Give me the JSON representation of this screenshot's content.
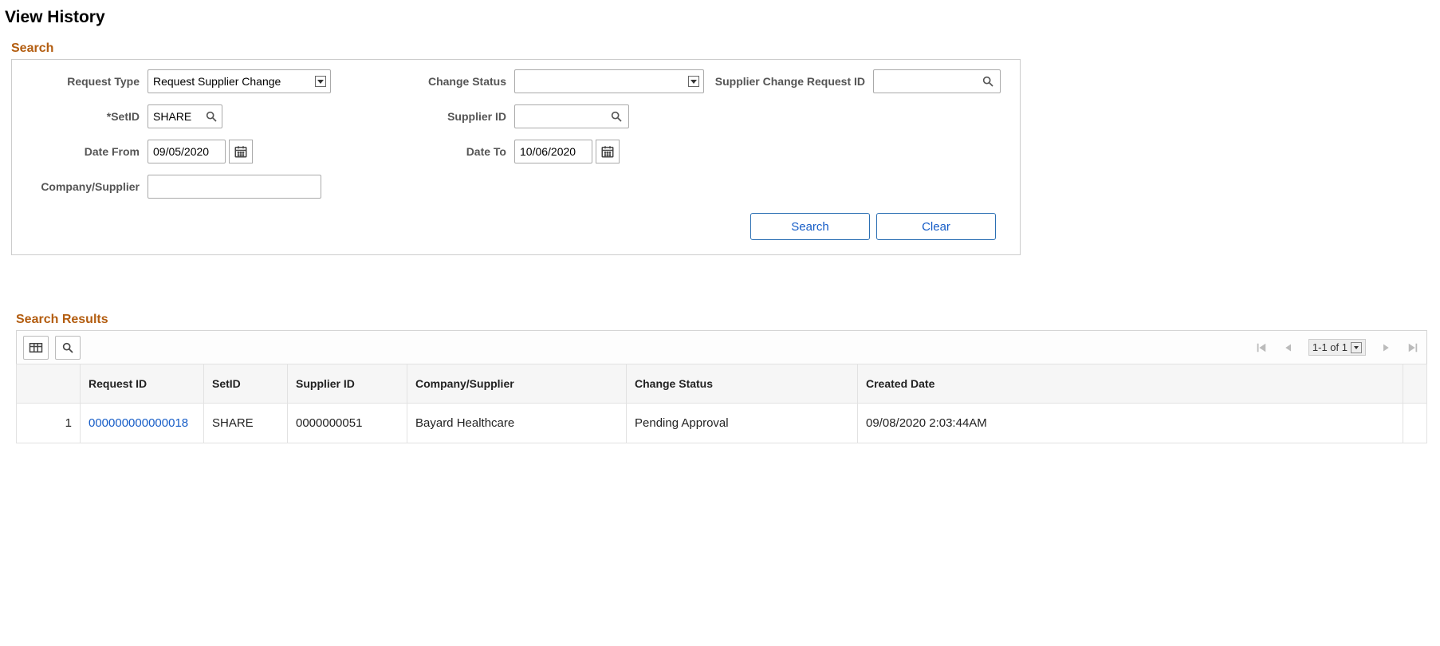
{
  "page": {
    "title": "View History"
  },
  "search_section": {
    "title": "Search"
  },
  "fields": {
    "request_type": {
      "label": "Request Type",
      "value": "Request Supplier Change"
    },
    "change_status": {
      "label": "Change Status",
      "value": ""
    },
    "supplier_change_request_id": {
      "label": "Supplier Change Request ID",
      "value": ""
    },
    "set_id": {
      "label": "*SetID",
      "value": "SHARE"
    },
    "supplier_id": {
      "label": "Supplier ID",
      "value": ""
    },
    "date_from": {
      "label": "Date From",
      "value": "09/05/2020"
    },
    "date_to": {
      "label": "Date To",
      "value": "10/06/2020"
    },
    "company_supplier": {
      "label": "Company/Supplier",
      "value": ""
    }
  },
  "buttons": {
    "search": "Search",
    "clear": "Clear"
  },
  "results_section": {
    "title": "Search Results"
  },
  "grid": {
    "range": "1-1 of 1",
    "columns": {
      "request_id": "Request ID",
      "set_id": "SetID",
      "supplier_id": "Supplier ID",
      "company_supplier": "Company/Supplier",
      "change_status": "Change Status",
      "created_date": "Created Date"
    },
    "rows": [
      {
        "num": "1",
        "request_id": "000000000000018",
        "set_id": "SHARE",
        "supplier_id": "0000000051",
        "company_supplier": "Bayard Healthcare",
        "change_status": "Pending Approval",
        "created_date": "09/08/2020  2:03:44AM"
      }
    ]
  }
}
